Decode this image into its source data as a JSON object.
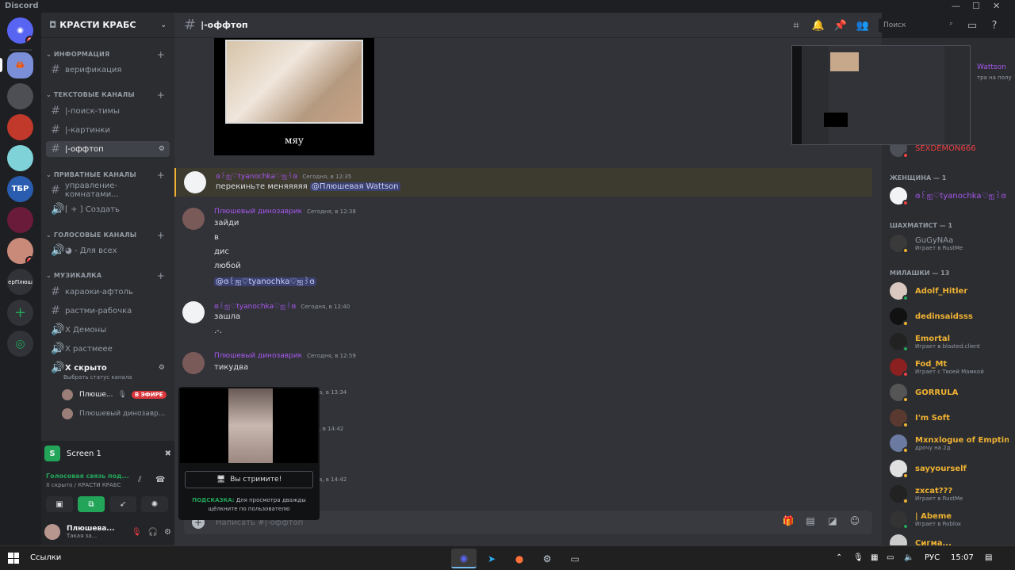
{
  "window": {
    "title": "Discord"
  },
  "servers": {
    "home_badge": "5",
    "badge2": "2",
    "named_server": "ерПлюш"
  },
  "guild": {
    "name": "КРАСТИ КРАБС"
  },
  "categories": {
    "info": "ИНФОРМАЦИЯ",
    "text": "ТЕКСТОВЫЕ КАНАЛЫ",
    "private": "ПРИВАТНЫЕ КАНАЛЫ",
    "voice": "ГОЛОСОВЫЕ КАНАЛЫ",
    "music": "МУЗИКАЛКА"
  },
  "channels": {
    "verify": "верификация",
    "search": "|-поиск-тимы",
    "pictures": "|-картинки",
    "offtop": "|-оффтоп",
    "manage": "управление-комнатами...",
    "create": "[ + ] Создать",
    "forall": "◕ - Для всех",
    "karaoke": "караоки-афтоль",
    "rastmi": "растми-рабочка",
    "demons": "Х Демоны",
    "rastmee": "Х растмеее",
    "hidden": "Х скрыто",
    "hidden_status": "Выбрать статус канала"
  },
  "voice_users": {
    "u1": "Плюше...",
    "live": "В ЭФИРЕ",
    "u2": "Плюшевый динозавр..."
  },
  "panel": {
    "screen": "Screen 1",
    "vc_status": "Голосовая связь под...",
    "vc_sub": "Х скрыто / КРАСТИ КРАБС",
    "user_name": "Плюшева...",
    "user_status": "Такая за..."
  },
  "topbar": {
    "channel": "|-оффтоп",
    "search_placeholder": "Поиск"
  },
  "cat_caption": "мяу",
  "messages": {
    "m1_name": "ɞ꒰ஐ♡tyanochka♡ஐ꒱ɞ",
    "m1_time": "Сегодня, в 12:35",
    "m1_text": "перекиньте меняяяяя ",
    "m1_ping": "@Плюшевая Wattson",
    "m2_name": "Плюшевый динозаврик",
    "m2_time": "Сегодня, в 12:38",
    "m2_l1": "зайди",
    "m2_l2": "в",
    "m2_l3": "дис",
    "m2_l4": "любой",
    "m2_ping": "@ɞ꒰ஐ♡tyanochka♡ஐ꒱ɞ",
    "m3_name": "ɞ꒰ஐ♡tyanochka♡ஐ꒱ɞ",
    "m3_time": "Сегодня, в 12:40",
    "m3_l1": "зашла",
    "m3_l2": ".-.",
    "m4_name": "Плюшевый динозаврик",
    "m4_time": "Сегодня, в 12:59",
    "m4_l1": "тикудва",
    "m5_time": "а, в 13:34",
    "m6_time": "а, в 14:42",
    "m7_time": "а, в 14:42"
  },
  "preview": {
    "stream_btn": "Вы стримите!",
    "hint_label": "ПОДСКАЗКА:",
    "hint_text": " Для просмотра дважды щёлкните по пользователю"
  },
  "composer": {
    "placeholder": "Написать #|-оффтоп"
  },
  "members": {
    "top_name": "SEXDEMON666",
    "top_name2": "Wattson",
    "top_sub": "тра на полу",
    "cat_woman": "ЖЕНЩИНА — 1",
    "woman1": "ɞ꒰ஐ♡tyanochka♡ஐ꒱ɞ",
    "cat_chess": "ШАХМАТИСТ — 1",
    "chess1": "GuGyNAa",
    "chess1_sub": "Играет в RustMe",
    "cat_cute": "МИЛАШКИ — 13",
    "list": [
      {
        "name": "Adolf_Hitler",
        "sub": ""
      },
      {
        "name": "dedinsaidsss",
        "sub": ""
      },
      {
        "name": "Emortal",
        "sub": "Играет в blasted.client"
      },
      {
        "name": "Fod_Mt",
        "sub": "Играет с Твоей Мамкой"
      },
      {
        "name": "GORRULA",
        "sub": ""
      },
      {
        "name": "I'm Soft",
        "sub": ""
      },
      {
        "name": "Mxnxlogue of Emptin...",
        "sub": "дрочу на 2д"
      },
      {
        "name": "sayyourself",
        "sub": ""
      },
      {
        "name": "zxcat???",
        "sub": "Играет в RustMe"
      },
      {
        "name": "| Abeme",
        "sub": "Играет в Roblox"
      },
      {
        "name": "Сигма...",
        "sub": ""
      }
    ]
  },
  "taskbar": {
    "label": "Ссылки",
    "lang": "РУС",
    "time": "15:07"
  }
}
